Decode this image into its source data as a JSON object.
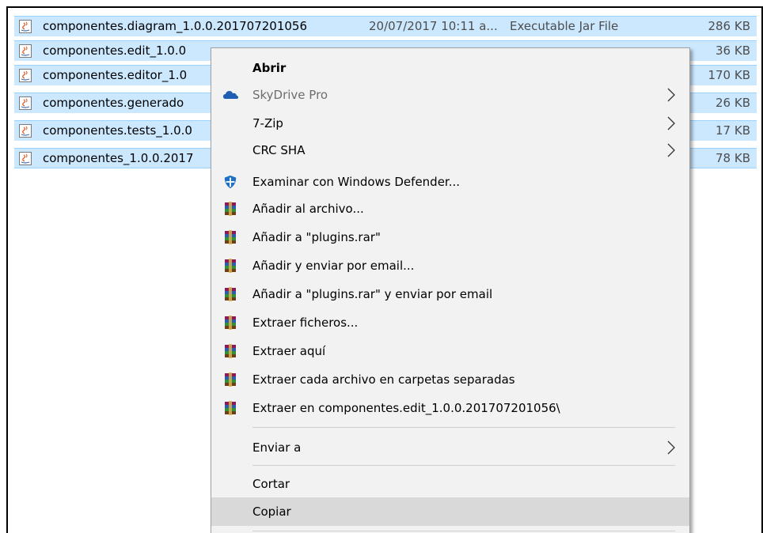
{
  "files": [
    {
      "name": "componentes.diagram_1.0.0.201707201056",
      "date": "20/07/2017 10:11 a...",
      "type": "Executable Jar File",
      "size": "286 KB"
    },
    {
      "name": "componentes.edit_1.0.0",
      "date": "",
      "type": "",
      "size": "36 KB"
    },
    {
      "name": "componentes.editor_1.0",
      "date": "",
      "type": "",
      "size": "170 KB"
    },
    {
      "name": "componentes.generado",
      "date": "",
      "type": "",
      "size": "26 KB"
    },
    {
      "name": "componentes.tests_1.0.0",
      "date": "",
      "type": "",
      "size": "17 KB"
    },
    {
      "name": "componentes_1.0.0.2017",
      "date": "",
      "type": "",
      "size": "78 KB"
    }
  ],
  "menu": {
    "open": "Abrir",
    "skydrive": "SkyDrive Pro",
    "zip7": "7-Zip",
    "crcsha": "CRC SHA",
    "defender": "Examinar con Windows Defender...",
    "add_archive": "Añadir al archivo...",
    "add_rar": "Añadir a \"plugins.rar\"",
    "add_email": "Añadir y enviar por email...",
    "add_rar_email": "Añadir a \"plugins.rar\" y enviar por email",
    "extract_files": "Extraer ficheros...",
    "extract_here": "Extraer aquí",
    "extract_each": "Extraer cada archivo en carpetas separadas",
    "extract_to": "Extraer en componentes.edit_1.0.0.201707201056\\",
    "send_to": "Enviar a",
    "cut": "Cortar",
    "copy": "Copiar"
  },
  "colors": {
    "selection": "#cce8ff",
    "selection_border": "#99d1ff",
    "menu_bg": "#f2f2f2",
    "menu_highlight": "#d9d9d9",
    "onedrive_blue": "#1e5fb4",
    "defender_blue": "#1f6fc2"
  },
  "icons": {
    "file": "jar-file-icon",
    "skydrive": "cloud-icon",
    "defender": "windows-defender-icon",
    "winrar": "winrar-books-icon",
    "submenu": "chevron-right-icon"
  }
}
